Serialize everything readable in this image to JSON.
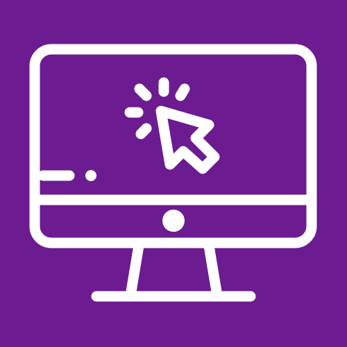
{
  "icon": {
    "name": "computer-click-icon",
    "background_color": "#6c1b91",
    "stroke_color": "#ffffff",
    "parts": [
      "monitor",
      "screen-divider",
      "power-button",
      "stand",
      "base",
      "cursor",
      "click-rays",
      "dash-line"
    ]
  }
}
